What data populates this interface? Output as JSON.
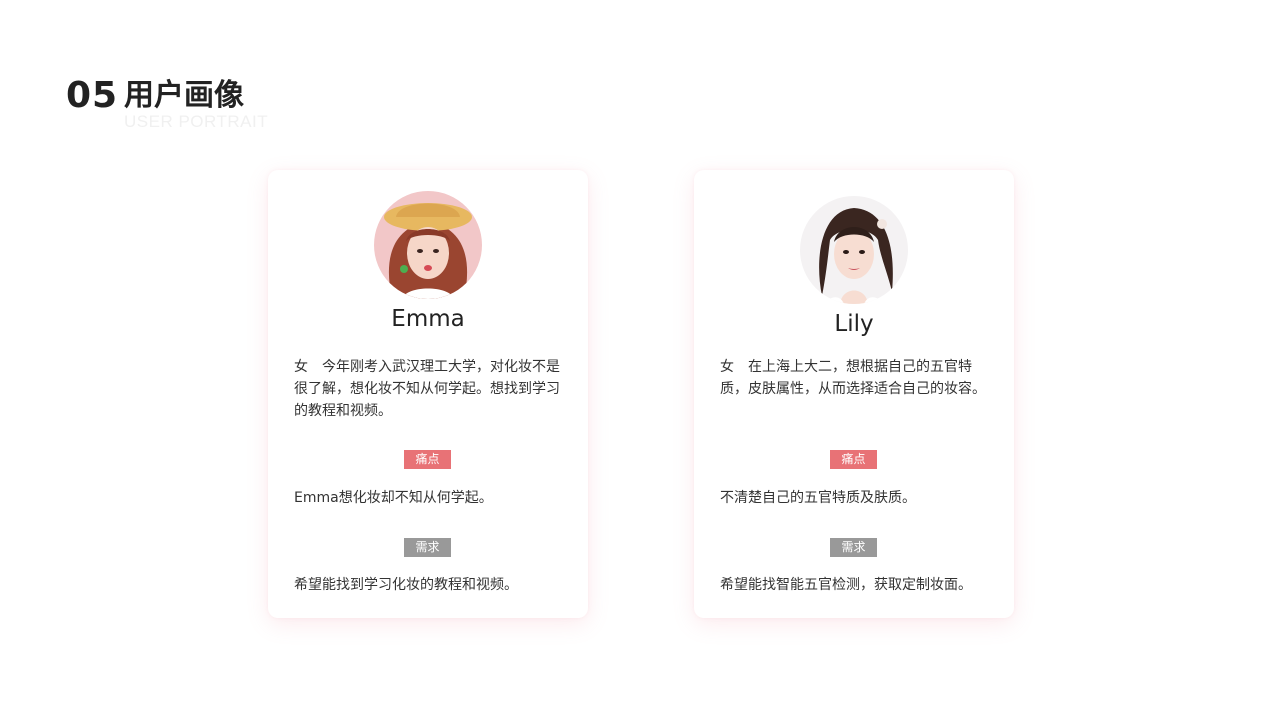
{
  "header": {
    "number": "05",
    "title": "用户画像",
    "subtitle": "USER PORTRAIT"
  },
  "labels": {
    "pain_point": "痛点",
    "need": "需求"
  },
  "personas": [
    {
      "name": "Emma",
      "gender": "女",
      "bio": "今年刚考入武汉理工大学，对化妆不是很了解，想化妆不知从何学起。想找到学习的教程和视频。",
      "pain_point": "Emma想化妆却不知从何学起。",
      "need": "希望能找到学习化妆的教程和视频。"
    },
    {
      "name": "Lily",
      "gender": "女",
      "bio": "在上海上大二，想根据自己的五官特质，皮肤属性，从而选择适合自己的妆容。",
      "pain_point": "不清楚自己的五官特质及肤质。",
      "need": "希望能找智能五官检测，获取定制妆面。"
    }
  ],
  "colors": {
    "pain_tag": "#e87276",
    "need_tag": "#999999",
    "card_shadow": "#eb8296"
  }
}
